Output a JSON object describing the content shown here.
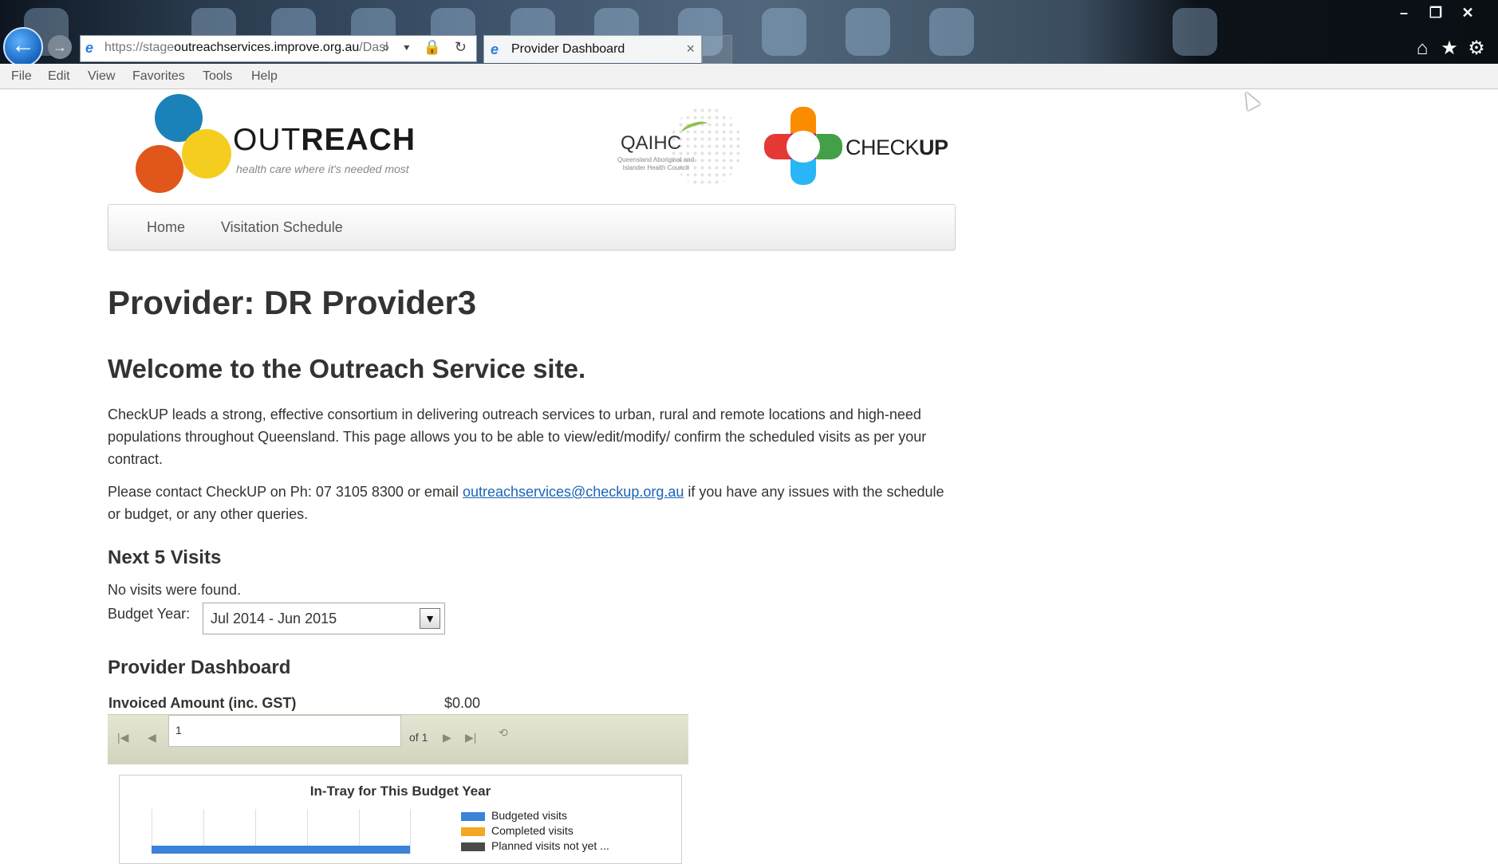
{
  "browser": {
    "url_host_light": "https://stage",
    "url_host_dark": "outreachservices.improve.org.au",
    "url_path": "/Dasl",
    "tab_title": "Provider Dashboard",
    "tab_close": "×",
    "nav_back_glyph": "←",
    "nav_fwd_glyph": "→",
    "address_tools": "⌕ ▾ 🔒 ↻",
    "window_controls": [
      "–",
      "❐",
      "✕"
    ],
    "tool_icons": [
      "⌂",
      "★",
      "⚙"
    ]
  },
  "menu": [
    "File",
    "Edit",
    "View",
    "Favorites",
    "Tools",
    "Help"
  ],
  "logos": {
    "outreach_light": "OUT",
    "outreach_bold": "REACH",
    "outreach_tagline": "health care where it's needed most",
    "qaihc": "QAIHC",
    "qaihc_sub": "Queensland Aboriginal and Islander Health Council",
    "checkup_light": "CHECK",
    "checkup_bold": "UP",
    "colors": {
      "blue": "#1a82b8",
      "orange": "#e1561b",
      "yellow": "#f5cd1f"
    }
  },
  "nav": {
    "home": "Home",
    "schedule": "Visitation Schedule"
  },
  "page": {
    "provider_title": "Provider: DR Provider3",
    "welcome": "Welcome to the Outreach Service site.",
    "intro": "CheckUP leads a strong, effective consortium in delivering outreach services to urban, rural and remote locations and high-need populations throughout Queensland. This page allows you to be able to view/edit/modify/ confirm the scheduled visits as per your contract.",
    "contact_before": "Please contact CheckUP on Ph: 07 3105 8300 or email ",
    "contact_email": "outreachservices@checkup.org.au",
    "contact_after": " if you have any issues with the schedule or budget, or any other queries."
  },
  "visits": {
    "heading": "Next 5 Visits",
    "empty": "No visits were found.",
    "budget_label": "Budget Year:",
    "budget_value": "Jul 2014 - Jun 2015"
  },
  "dashboard": {
    "heading": "Provider Dashboard",
    "invoiced_label": "Invoiced Amount (inc. GST)",
    "invoiced_value": "$0.00",
    "pager_page": "1",
    "pager_of": "of 1"
  },
  "chart_data": {
    "type": "bar",
    "title": "In-Tray for This Budget Year",
    "legend": [
      "Budgeted visits",
      "Completed visits",
      "Planned visits not yet ..."
    ],
    "series_colors": [
      "#3b82d8",
      "#f5a623",
      "#4a4a4a"
    ]
  }
}
